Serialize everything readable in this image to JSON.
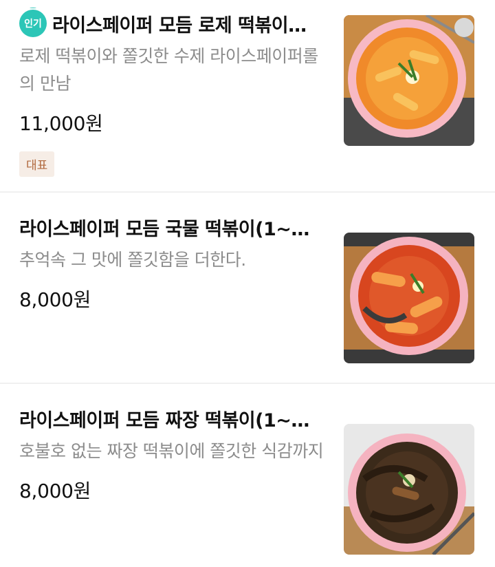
{
  "menu": {
    "items": [
      {
        "badge": "인기",
        "title": "라이스페이퍼 모듬 로제 떡볶이…",
        "description": "로제 떡볶이와 쫄깃한 수제 라이스페이퍼롤의 만남",
        "price": "11,000원",
        "tag": "대표",
        "image_icon": "rose-tteokbokki-photo"
      },
      {
        "title": "라이스페이퍼 모듬 국물 떡볶이(1~…",
        "description": "추억속 그 맛에 쫄깃함을 더한다.",
        "price": "8,000원",
        "image_icon": "soup-tteokbokki-photo"
      },
      {
        "title": "라이스페이퍼 모듬 짜장 떡볶이(1~…",
        "description": "호불호 없는 짜장 떡볶이에 쫄깃한 식감까지",
        "price": "8,000원",
        "image_icon": "jjajang-tteokbokki-photo"
      }
    ]
  },
  "colors": {
    "badge": "#2cc6b7",
    "tag_bg": "#f6ede6",
    "tag_text": "#b0673c",
    "description": "#8c8c8c",
    "divider": "#f0f0f0"
  }
}
